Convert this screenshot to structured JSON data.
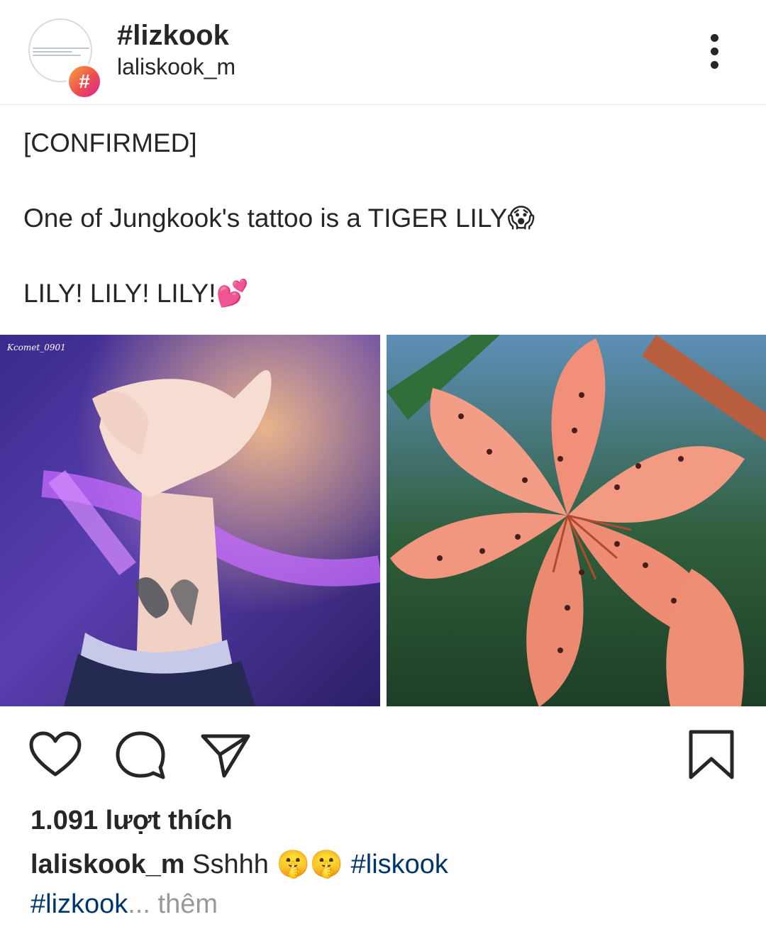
{
  "header": {
    "title": "#lizkook",
    "subtitle": "laliskook_m",
    "badge_symbol": "#"
  },
  "caption": {
    "line1": "[CONFIRMED]",
    "line2_text": "One of Jungkook's tattoo is a TIGER LILY",
    "line2_emoji": "😱",
    "line3_text": "LILY! LILY! LILY!",
    "line3_emoji": "💕"
  },
  "images": {
    "left_watermark": "Kcomet_0901",
    "left_icon": "photo-tattoo-hand",
    "right_icon": "photo-tiger-lily"
  },
  "actions": {
    "like_icon": "heart-icon",
    "comment_icon": "comment-icon",
    "share_icon": "send-icon",
    "save_icon": "bookmark-icon"
  },
  "likes": "1.091 lượt thích",
  "post_caption": {
    "username": "laliskook_m",
    "text": "Sshhh",
    "emoji": "🤫🤫",
    "hashtag1": "#liskook",
    "hashtag2": "#lizkook",
    "ellipsis": "...",
    "more_label": "thêm"
  },
  "colors": {
    "text": "#262626",
    "hashtag": "#003569",
    "muted": "#999999",
    "divider": "#e6e6e6"
  }
}
